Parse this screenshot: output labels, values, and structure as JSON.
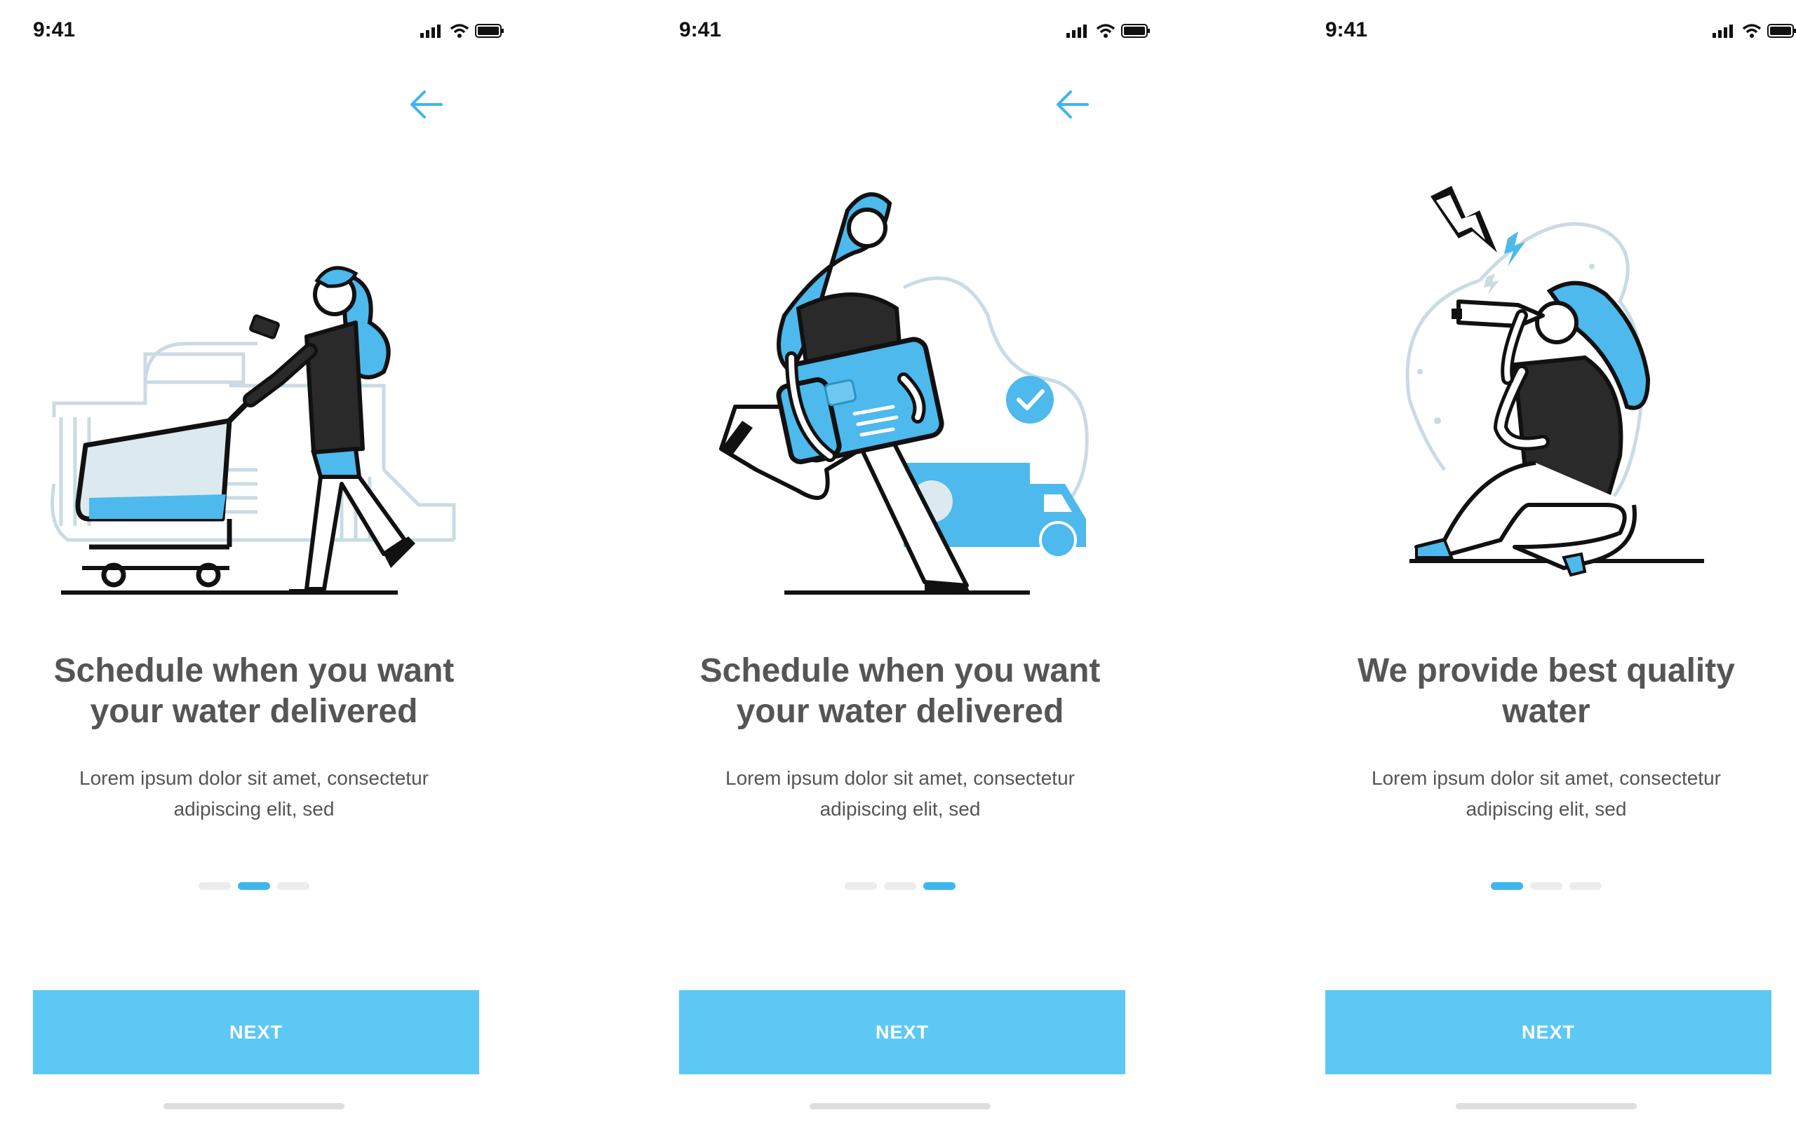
{
  "colors": {
    "accent": "#5ec8f5",
    "accent_dark": "#3db6ee",
    "title_text": "#555555",
    "dot_inactive": "#ececec"
  },
  "screens": [
    {
      "status_time": "9:41",
      "title_line1": "Schedule when you want",
      "title_line2": "your water delivered",
      "body_line1": "Lorem ipsum dolor sit amet, consectetur",
      "body_line2": "adipiscing elit, sed",
      "illustration": "woman-with-shopping-cart",
      "active_page": 2,
      "page_count": 3,
      "button_label": "NEXT",
      "back_icon": "arrow-left-icon"
    },
    {
      "status_time": "9:41",
      "title_line1": "Schedule when you want",
      "title_line2": "your water delivered",
      "body_line1": "Lorem ipsum dolor sit amet, consectetur",
      "body_line2": "adipiscing elit, sed",
      "illustration": "woman-running-with-package-and-truck",
      "active_page": 3,
      "page_count": 3,
      "button_label": "NEXT",
      "back_icon": "arrow-left-icon"
    },
    {
      "status_time": "9:41",
      "title_line1": "We provide best quality",
      "title_line2": "water",
      "body_line1": "Lorem ipsum dolor sit amet, consectetur",
      "body_line2": "adipiscing elit, sed",
      "illustration": "woman-sitting-drinking-water",
      "active_page": 1,
      "page_count": 3,
      "button_label": "NEXT"
    }
  ]
}
